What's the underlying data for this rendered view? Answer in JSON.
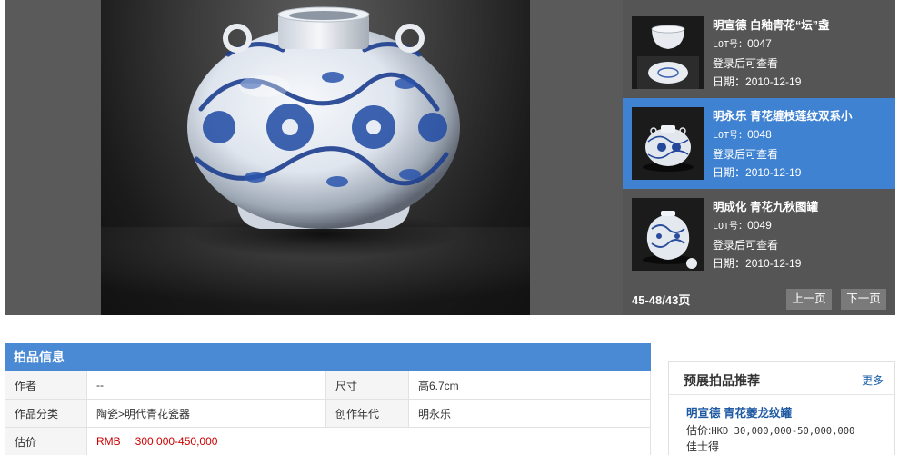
{
  "viewer": {
    "main_image": "blue-and-white-jar-photo",
    "lots": [
      {
        "title": "明宣德 白釉青花“坛”盏",
        "lot_label": "LOT号：",
        "lot_no": "0047",
        "login_note": "登录后可查看",
        "date_label": "日期：",
        "date": "2010-12-19",
        "active": false,
        "thumb": "bowl-and-dish-photo"
      },
      {
        "title": "明永乐 青花缠枝莲纹双系小",
        "lot_label": "LOT号：",
        "lot_no": "0048",
        "login_note": "登录后可查看",
        "date_label": "日期：",
        "date": "2010-12-19",
        "active": true,
        "thumb": "twin-handled-jar-photo"
      },
      {
        "title": "明成化 青花九秋图罐",
        "lot_label": "LOT号：",
        "lot_no": "0049",
        "login_note": "登录后可查看",
        "date_label": "日期：",
        "date": "2010-12-19",
        "active": false,
        "thumb": "covered-jar-photo"
      }
    ],
    "pager": {
      "info": "45-48/43页",
      "prev": "上一页",
      "next": "下一页"
    }
  },
  "auction_info": {
    "heading": "拍品信息",
    "rows": [
      {
        "label1": "作者",
        "value1": "--",
        "label2": "尺寸",
        "value2": "高6.7cm"
      },
      {
        "label1": "作品分类",
        "value1": "陶瓷>明代青花瓷器",
        "label2": "创作年代",
        "value2": "明永乐"
      }
    ],
    "price_label": "估价",
    "price_currency": "RMB",
    "price_range": "300,000-450,000"
  },
  "recommend": {
    "title": "预展拍品推荐",
    "more": "更多",
    "item": {
      "name": "明宣德 青花夔龙纹罐",
      "estimate_label": "估价:",
      "estimate_value": "HKD 30,000,000-50,000,000",
      "result": "佳士得"
    }
  },
  "colors": {
    "active_blue": "#3f82d2",
    "header_blue": "#4a8ad4",
    "price_red": "#cc0000",
    "link_blue": "#1a5fa8"
  }
}
